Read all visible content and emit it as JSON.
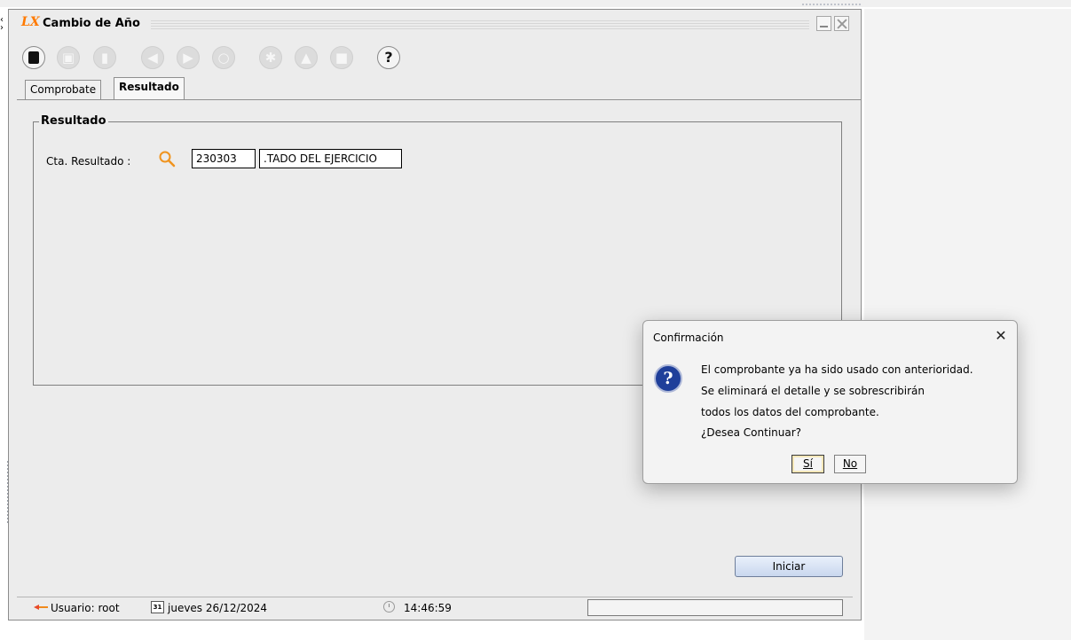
{
  "window": {
    "app_logo": "LX",
    "title": "Cambio de Año"
  },
  "toolbar": {
    "buttons": [
      "new-document",
      "save",
      "delete",
      "previous",
      "next",
      "find",
      "process",
      "print",
      "print-preview",
      "help"
    ],
    "help_glyph": "?"
  },
  "tabs": [
    {
      "label": "Comprobate",
      "selected": false
    },
    {
      "label": "Resultado",
      "selected": true
    }
  ],
  "panel": {
    "title": "Resultado",
    "cta_label": "Cta. Resultado :",
    "cta_code": "230303",
    "cta_description": ".TADO DEL EJERCICIO"
  },
  "actions": {
    "start_label": "Iniciar"
  },
  "statusbar": {
    "user": "Usuario: root",
    "calendar_glyph": "31",
    "date": "jueves 26/12/2024",
    "time": "14:46:59"
  },
  "dialog": {
    "title": "Confirmación",
    "close_glyph": "✕",
    "icon_glyph": "?",
    "lines": [
      "El comprobante ya ha sido usado con anterioridad.",
      "Se eliminará el detalle y se sobrescribirán",
      "todos los datos del comprobante.",
      "¿Desea Continuar?"
    ],
    "yes_label": "Sí",
    "no_label": "No"
  },
  "colors": {
    "accent_orange": "#ff7a00",
    "dialog_icon_blue": "#1f3f9a",
    "window_bg": "#ececec"
  }
}
